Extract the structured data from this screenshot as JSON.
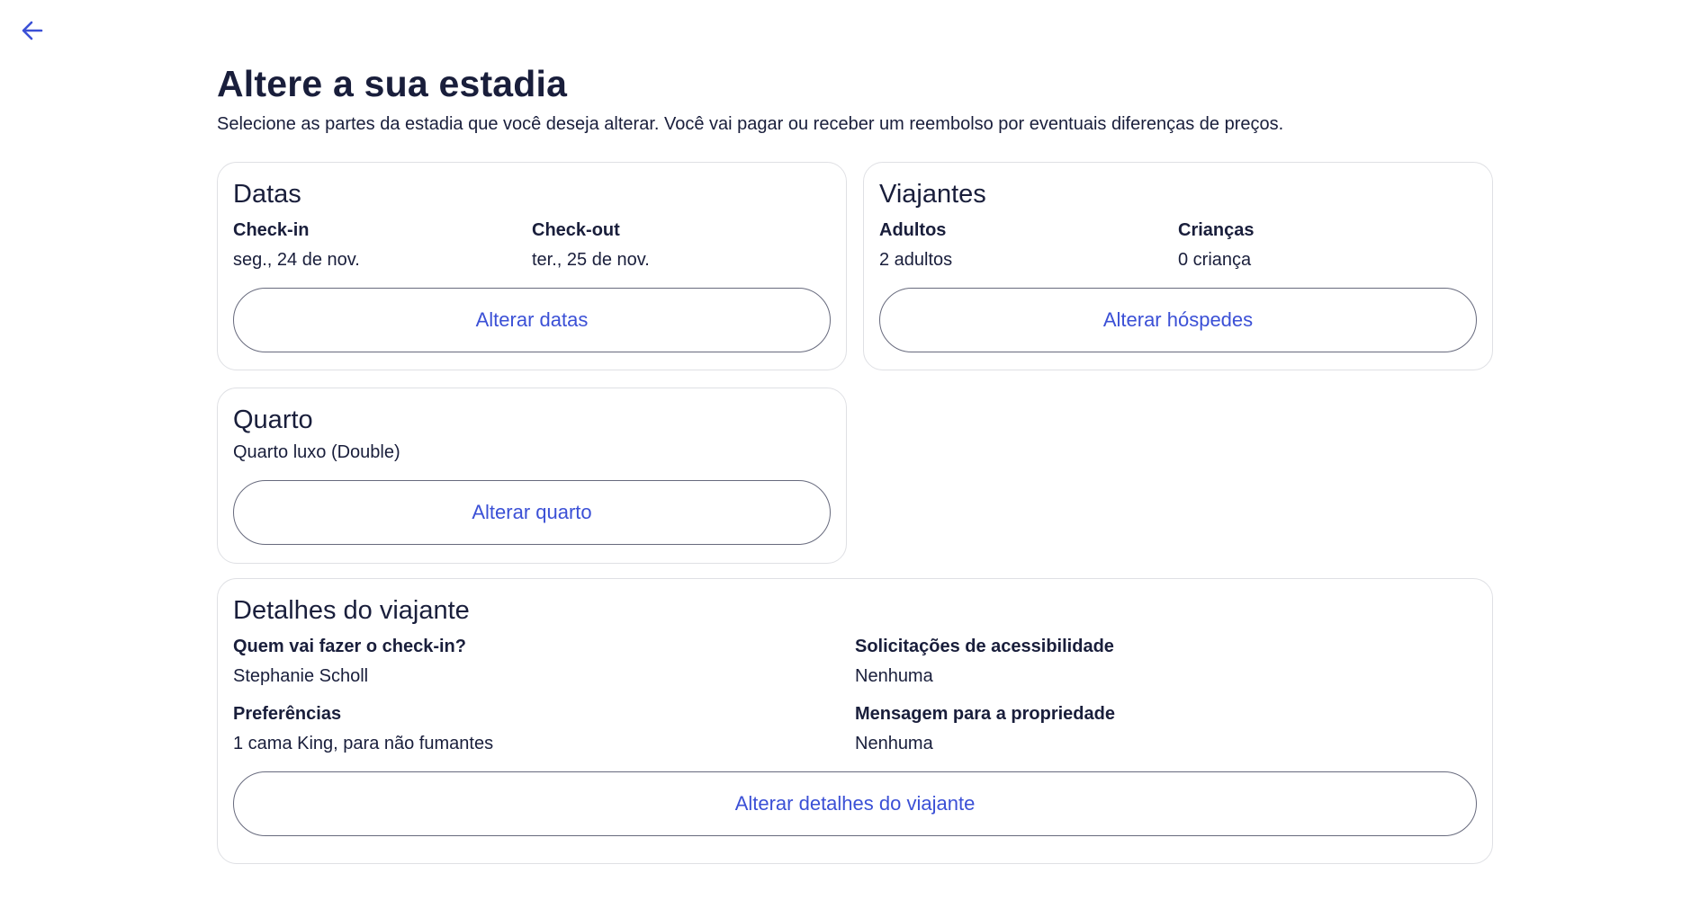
{
  "header": {
    "back_icon": "arrow-left-icon",
    "title": "Altere a sua estadia",
    "subtitle": "Selecione as partes da estadia que você deseja alterar. Você vai pagar ou receber um reembolso por eventuais diferenças de preços."
  },
  "dates": {
    "title": "Datas",
    "checkin_label": "Check-in",
    "checkin_value": "seg., 24 de nov.",
    "checkout_label": "Check-out",
    "checkout_value": "ter., 25 de nov.",
    "button": "Alterar datas"
  },
  "travelers": {
    "title": "Viajantes",
    "adults_label": "Adultos",
    "adults_value": "2 adultos",
    "children_label": "Crianças",
    "children_value": "0 criança",
    "button": "Alterar hóspedes"
  },
  "room": {
    "title": "Quarto",
    "value": "Quarto luxo (Double)",
    "button": "Alterar quarto"
  },
  "traveler_details": {
    "title": "Detalhes do viajante",
    "checkin_person_label": "Quem vai fazer o check-in?",
    "checkin_person_value": "Stephanie Scholl",
    "accessibility_label": "Solicitações de acessibilidade",
    "accessibility_value": "Nenhuma",
    "preferences_label": "Preferências",
    "preferences_value": "1 cama King, para não fumantes",
    "message_label": "Mensagem para a propriedade",
    "message_value": "Nenhuma",
    "button": "Alterar detalhes do viajante"
  },
  "colors": {
    "text": "#191e3b",
    "accent": "#3b50d6",
    "border": "#dfe0e4"
  }
}
